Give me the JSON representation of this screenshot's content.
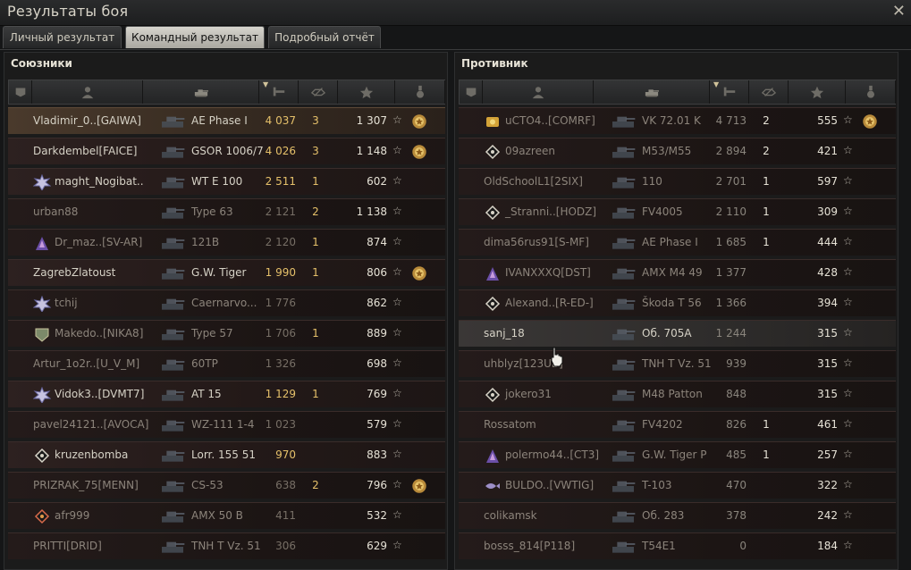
{
  "window": {
    "title": "Результаты боя"
  },
  "tabs": [
    {
      "label": "Личный результат"
    },
    {
      "label": "Командный результат"
    },
    {
      "label": "Подробный отчёт"
    }
  ],
  "colors": {
    "damage": "#e5c06a",
    "text": "#d6d2c6",
    "muted": "#8c847b",
    "active_tab": "#d6d4cd"
  },
  "allies": {
    "title": "Союзники",
    "rows": [
      {
        "name": "Vladimir_0..[GAIWA]",
        "vehicle": "AE Phase I",
        "damage": "4 037",
        "kills": "3",
        "xp": "1 307",
        "medal": true,
        "badge": "",
        "state": "me"
      },
      {
        "name": "Darkdembel[FAICE]",
        "vehicle": "GSOR 1006/7",
        "damage": "4 026",
        "kills": "3",
        "xp": "1 148",
        "medal": true,
        "badge": "",
        "state": "alive"
      },
      {
        "name": "maght_Nogibat..",
        "vehicle": "WT E 100",
        "damage": "2 511",
        "kills": "1",
        "xp": "602",
        "medal": false,
        "badge": "clan-emblem-icon",
        "state": "alive"
      },
      {
        "name": "urban88",
        "vehicle": "Type 63",
        "damage": "2 121",
        "kills": "2",
        "xp": "1 138",
        "medal": false,
        "badge": "",
        "state": "dead"
      },
      {
        "name": "Dr_maz..[SV-AR]",
        "vehicle": "121B",
        "damage": "2 120",
        "kills": "1",
        "xp": "874",
        "medal": false,
        "badge": "rank-icon",
        "state": "dead"
      },
      {
        "name": "ZagrebZlatoust",
        "vehicle": "G.W. Tiger",
        "damage": "1 990",
        "kills": "1",
        "xp": "806",
        "medal": true,
        "badge": "",
        "state": "alive"
      },
      {
        "name": "tchij",
        "vehicle": "Caernarvo...",
        "damage": "1 776",
        "kills": "",
        "xp": "862",
        "medal": false,
        "badge": "clan-emblem-icon",
        "state": "dead"
      },
      {
        "name": "Makedo..[NIKA8]",
        "vehicle": "Type 57",
        "damage": "1 706",
        "kills": "1",
        "xp": "889",
        "medal": false,
        "badge": "shield-emblem-icon",
        "state": "dead"
      },
      {
        "name": "Artur_1o2r..[U_V_M]",
        "vehicle": "60TP",
        "damage": "1 326",
        "kills": "",
        "xp": "698",
        "medal": false,
        "badge": "",
        "state": "dead"
      },
      {
        "name": "Vidok3..[DVMT7]",
        "vehicle": "AT 15",
        "damage": "1 129",
        "kills": "1",
        "xp": "769",
        "medal": false,
        "badge": "clan-emblem-icon",
        "state": "alive"
      },
      {
        "name": "pavel24121..[AVOCA]",
        "vehicle": "WZ-111 1-4",
        "damage": "1 023",
        "kills": "",
        "xp": "579",
        "medal": false,
        "badge": "",
        "state": "dead"
      },
      {
        "name": "kruzenbomba",
        "vehicle": "Lorr. 155 51",
        "damage": "970",
        "kills": "",
        "xp": "883",
        "medal": false,
        "badge": "diamond-icon",
        "state": "alive"
      },
      {
        "name": "PRIZRAK_75[MENN]",
        "vehicle": "CS-53",
        "damage": "638",
        "kills": "2",
        "xp": "796",
        "medal": true,
        "badge": "",
        "state": "dead"
      },
      {
        "name": "afr999",
        "vehicle": "AMX 50 B",
        "damage": "411",
        "kills": "",
        "xp": "532",
        "medal": false,
        "badge": "diamond-red-icon",
        "state": "dead"
      },
      {
        "name": "PRITTI[DRID]",
        "vehicle": "TNH T Vz. 51",
        "damage": "306",
        "kills": "",
        "xp": "629",
        "medal": false,
        "badge": "",
        "state": "dead"
      }
    ]
  },
  "enemies": {
    "title": "Противник",
    "rows": [
      {
        "name": "uCTO4..[COMRF]",
        "vehicle": "VK 72.01 K",
        "damage": "4 713",
        "kills": "2",
        "xp": "555",
        "medal": true,
        "badge": "gold-badge-icon",
        "state": "dead"
      },
      {
        "name": "09azreen",
        "vehicle": "M53/M55",
        "damage": "2 894",
        "kills": "2",
        "xp": "421",
        "medal": false,
        "badge": "diamond-icon",
        "state": "dead"
      },
      {
        "name": "OldSchoolL1[2SIX]",
        "vehicle": "110",
        "damage": "2 701",
        "kills": "1",
        "xp": "597",
        "medal": false,
        "badge": "",
        "state": "dead"
      },
      {
        "name": "_Stranni..[HODZ]",
        "vehicle": "FV4005",
        "damage": "2 110",
        "kills": "1",
        "xp": "309",
        "medal": false,
        "badge": "diamond-icon",
        "state": "dead"
      },
      {
        "name": "dima56rus91[S-MF]",
        "vehicle": "AE Phase I",
        "damage": "1 685",
        "kills": "1",
        "xp": "444",
        "medal": false,
        "badge": "",
        "state": "dead"
      },
      {
        "name": "IVANXXXQ[DST]",
        "vehicle": "AMX M4 49",
        "damage": "1 377",
        "kills": "",
        "xp": "428",
        "medal": false,
        "badge": "rank-icon",
        "state": "dead"
      },
      {
        "name": "Alexand..[R-ED-]",
        "vehicle": "Škoda T 56",
        "damage": "1 366",
        "kills": "",
        "xp": "394",
        "medal": false,
        "badge": "diamond-icon",
        "state": "dead"
      },
      {
        "name": "sanj_18",
        "vehicle": "Об. 705А",
        "damage": "1 244",
        "kills": "",
        "xp": "315",
        "medal": false,
        "badge": "",
        "state": "hl"
      },
      {
        "name": "uhblyz[123UB]",
        "vehicle": "TNH T Vz. 51",
        "damage": "939",
        "kills": "",
        "xp": "315",
        "medal": false,
        "badge": "",
        "state": "dead"
      },
      {
        "name": "jokero31",
        "vehicle": "M48 Patton",
        "damage": "848",
        "kills": "",
        "xp": "315",
        "medal": false,
        "badge": "diamond-icon",
        "state": "dead"
      },
      {
        "name": "Rossatom",
        "vehicle": "FV4202",
        "damage": "826",
        "kills": "1",
        "xp": "461",
        "medal": false,
        "badge": "",
        "state": "dead"
      },
      {
        "name": "polermo44..[CT3]",
        "vehicle": "G.W. Tiger P",
        "damage": "485",
        "kills": "1",
        "xp": "257",
        "medal": false,
        "badge": "rank-icon",
        "state": "dead"
      },
      {
        "name": "BULDO..[VWTIG]",
        "vehicle": "T-103",
        "damage": "470",
        "kills": "",
        "xp": "322",
        "medal": false,
        "badge": "fish-emblem-icon",
        "state": "dead"
      },
      {
        "name": "colikamsk",
        "vehicle": "Об. 283",
        "damage": "378",
        "kills": "",
        "xp": "242",
        "medal": false,
        "badge": "",
        "state": "dead"
      },
      {
        "name": "bosss_814[P118]",
        "vehicle": "T54E1",
        "damage": "0",
        "kills": "",
        "xp": "184",
        "medal": false,
        "badge": "",
        "state": "dead"
      }
    ]
  }
}
